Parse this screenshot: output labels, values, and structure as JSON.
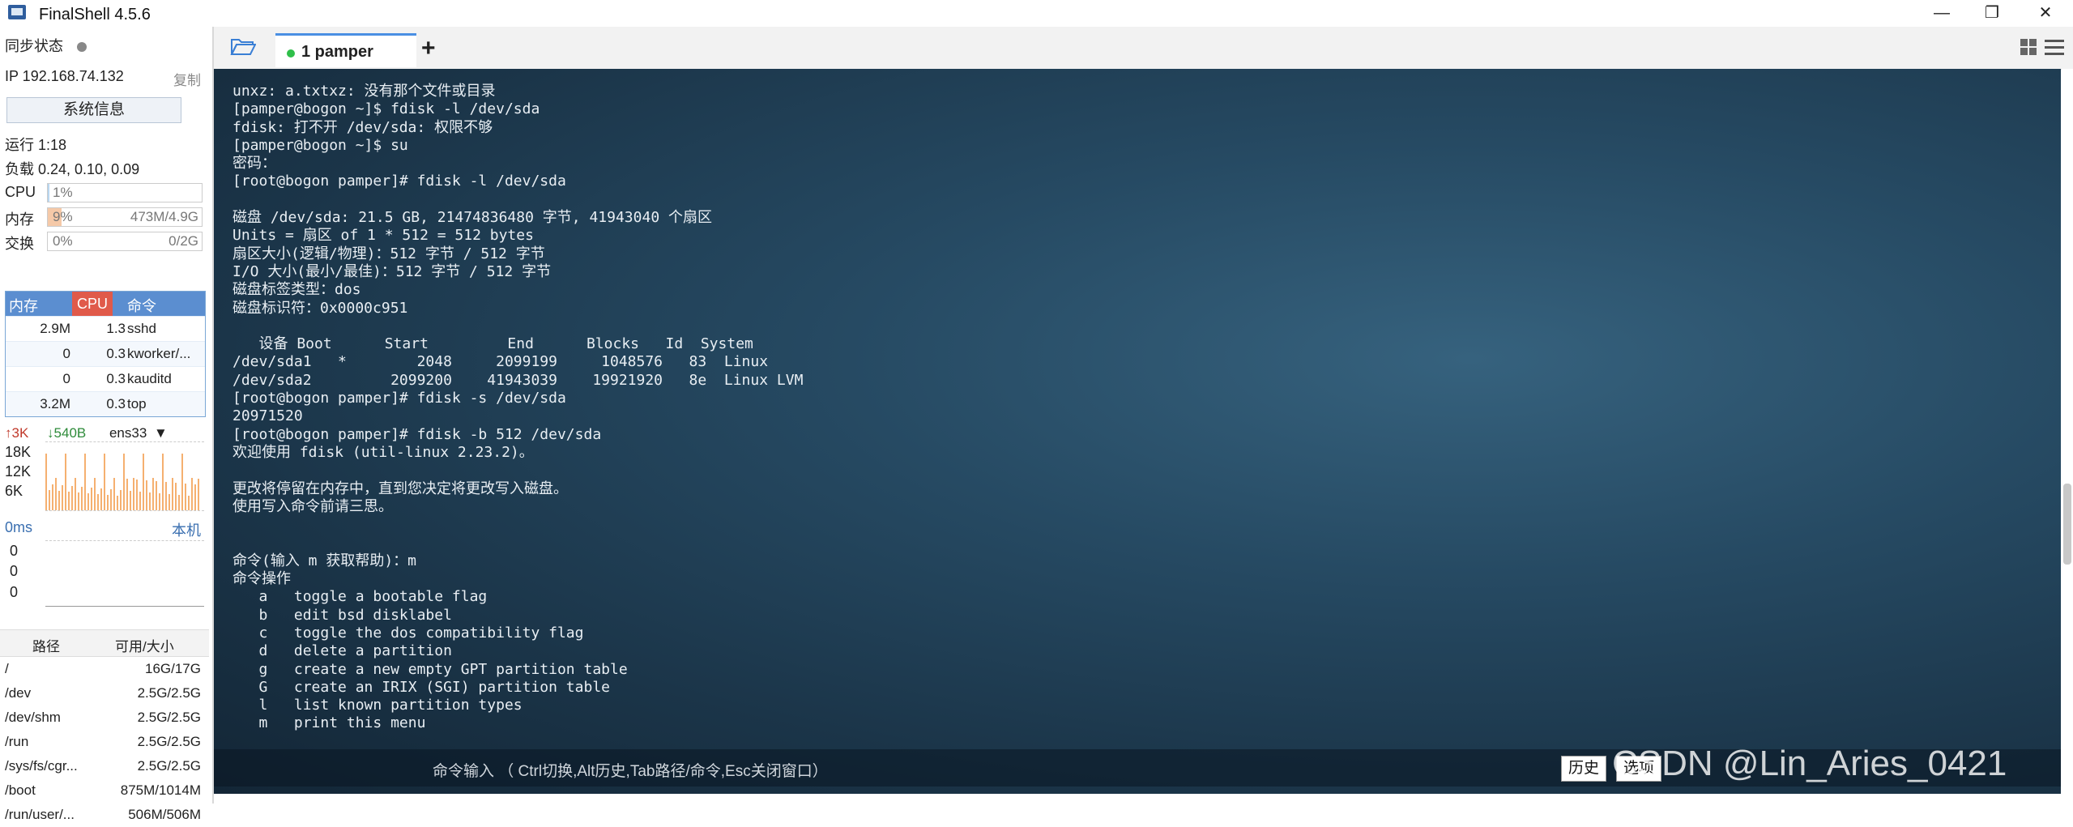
{
  "app": {
    "title": "FinalShell 4.5.6",
    "window_controls": [
      "—",
      "❐",
      "✕"
    ]
  },
  "sidebar": {
    "sync_label": "同步状态",
    "ip_label": "IP  192.168.74.132",
    "copy_label": "复制",
    "sysinfo_button": "系统信息",
    "uptime": "运行 1:18",
    "load": "负载 0.24, 0.10, 0.09",
    "cpu": {
      "label": "CPU",
      "value": "1%",
      "fraction": 0.01
    },
    "mem": {
      "label": "内存",
      "value": "9%",
      "detail": "473M/4.9G",
      "fraction": 0.09
    },
    "swap": {
      "label": "交换",
      "value": "0%",
      "detail": "0/2G",
      "fraction": 0.0
    },
    "proc_headers": [
      "内存",
      "CPU",
      "命令"
    ],
    "processes": [
      {
        "mem": "2.9M",
        "cpu": "1.3",
        "cmd": "sshd"
      },
      {
        "mem": "0",
        "cpu": "0.3",
        "cmd": "kworker/..."
      },
      {
        "mem": "0",
        "cpu": "0.3",
        "cmd": "kauditd"
      },
      {
        "mem": "3.2M",
        "cpu": "0.3",
        "cmd": "top"
      }
    ],
    "net": {
      "up": "3K",
      "down": "540B",
      "iface": "ens33",
      "ticks": [
        "18K",
        "12K",
        "6K"
      ]
    },
    "ping": {
      "latency": "0ms",
      "target": "本机",
      "ticks": [
        "0",
        "0",
        "0"
      ]
    },
    "disk_headers": [
      "路径",
      "可用/大小"
    ],
    "disks": [
      {
        "path": "/",
        "size": "16G/17G"
      },
      {
        "path": "/dev",
        "size": "2.5G/2.5G"
      },
      {
        "path": "/dev/shm",
        "size": "2.5G/2.5G"
      },
      {
        "path": "/run",
        "size": "2.5G/2.5G"
      },
      {
        "path": "/sys/fs/cgr...",
        "size": "2.5G/2.5G"
      },
      {
        "path": "/boot",
        "size": "875M/1014M"
      },
      {
        "path": "/run/user/...",
        "size": "506M/506M"
      }
    ]
  },
  "tabs": {
    "active": "1 pamper",
    "add": "+"
  },
  "terminal": {
    "lines": [
      "unxz: a.txtxz: 没有那个文件或目录",
      "[pamper@bogon ~]$ fdisk -l /dev/sda",
      "fdisk: 打不开 /dev/sda: 权限不够",
      "[pamper@bogon ~]$ su",
      "密码：",
      "[root@bogon pamper]# fdisk -l /dev/sda",
      "",
      "磁盘 /dev/sda: 21.5 GB, 21474836480 字节, 41943040 个扇区",
      "Units = 扇区 of 1 * 512 = 512 bytes",
      "扇区大小(逻辑/物理)：512 字节 / 512 字节",
      "I/O 大小(最小/最佳)：512 字节 / 512 字节",
      "磁盘标签类型：dos",
      "磁盘标识符：0x0000c951",
      "",
      "   设备 Boot      Start         End      Blocks   Id  System",
      "/dev/sda1   *        2048     2099199     1048576   83  Linux",
      "/dev/sda2         2099200    41943039    19921920   8e  Linux LVM",
      "[root@bogon pamper]# fdisk -s /dev/sda",
      "20971520",
      "[root@bogon pamper]# fdisk -b 512 /dev/sda",
      "欢迎使用 fdisk (util-linux 2.23.2)。",
      "",
      "更改将停留在内存中，直到您决定将更改写入磁盘。",
      "使用写入命令前请三思。",
      "",
      "",
      "命令(输入 m 获取帮助)：m",
      "命令操作",
      "   a   toggle a bootable flag",
      "   b   edit bsd disklabel",
      "   c   toggle the dos compatibility flag",
      "   d   delete a partition",
      "   g   create a new empty GPT partition table",
      "   G   create an IRIX (SGI) partition table",
      "   l   list known partition types",
      "   m   print this menu"
    ]
  },
  "cmdbar": {
    "placeholder": "命令输入 （ Ctrl切换,Alt历史,Tab路径/命令,Esc关闭窗口）",
    "history_btn": "历史",
    "options_btn": "选项",
    "watermark": "CSDN @Lin_Aries_0421"
  },
  "colors": {
    "accent": "#4a8fe3",
    "tab_dot": "#2fbf4a",
    "mem_fill": "#f5c9a8",
    "net_bar": "#f5b070"
  }
}
